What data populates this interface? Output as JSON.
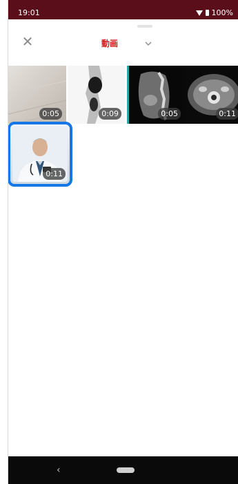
{
  "status_bar": {
    "time": "19:01",
    "battery": "100%"
  },
  "header": {
    "title": "動画"
  },
  "media": [
    {
      "duration": "0:05"
    },
    {
      "duration": "0:09"
    },
    {
      "duration": "0:05"
    },
    {
      "duration": "0:11"
    },
    {
      "duration": "0:11"
    }
  ],
  "colors": {
    "status_bar_bg": "#5a0e1a",
    "accent_red": "#d02020",
    "selection_blue": "#1677e6"
  }
}
